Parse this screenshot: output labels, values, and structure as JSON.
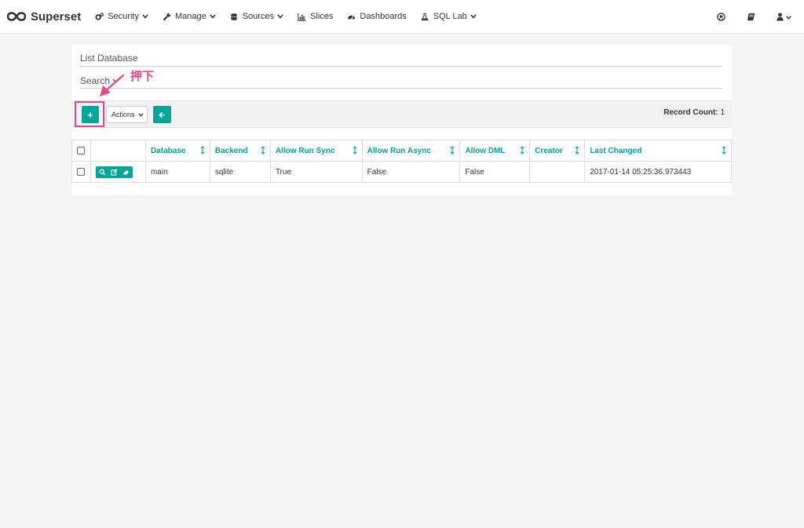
{
  "navbar": {
    "brand": "Superset",
    "items": [
      {
        "label": "Security",
        "icon": "cogs-icon",
        "dropdown": true
      },
      {
        "label": "Manage",
        "icon": "wrench-icon",
        "dropdown": true
      },
      {
        "label": "Sources",
        "icon": "database-icon",
        "dropdown": true
      },
      {
        "label": "Slices",
        "icon": "bar-chart-icon",
        "dropdown": false
      },
      {
        "label": "Dashboards",
        "icon": "dashboard-icon",
        "dropdown": false
      },
      {
        "label": "SQL Lab",
        "icon": "flask-icon",
        "dropdown": true
      }
    ],
    "right_icons": [
      "github-icon",
      "book-icon",
      "user-icon"
    ]
  },
  "panel": {
    "title": "List Database",
    "search_label": "Search"
  },
  "toolbar": {
    "add_label": "+",
    "actions_label": "Actions",
    "record_count_label": "Record Count:",
    "record_count": "1"
  },
  "annotation": {
    "text": "押下",
    "color": "#e8488a"
  },
  "table": {
    "columns": [
      "Database",
      "Backend",
      "Allow Run Sync",
      "Allow Run Async",
      "Allow DML",
      "Creator",
      "Last Changed"
    ],
    "rows": [
      {
        "database": "main",
        "backend": "sqlite",
        "allow_run_sync": "True",
        "allow_run_async": "False",
        "allow_dml": "False",
        "creator": "",
        "last_changed": "2017-01-14 05:25:36.973443"
      }
    ]
  },
  "colors": {
    "accent": "#00a699",
    "annotation": "#e8488a"
  }
}
